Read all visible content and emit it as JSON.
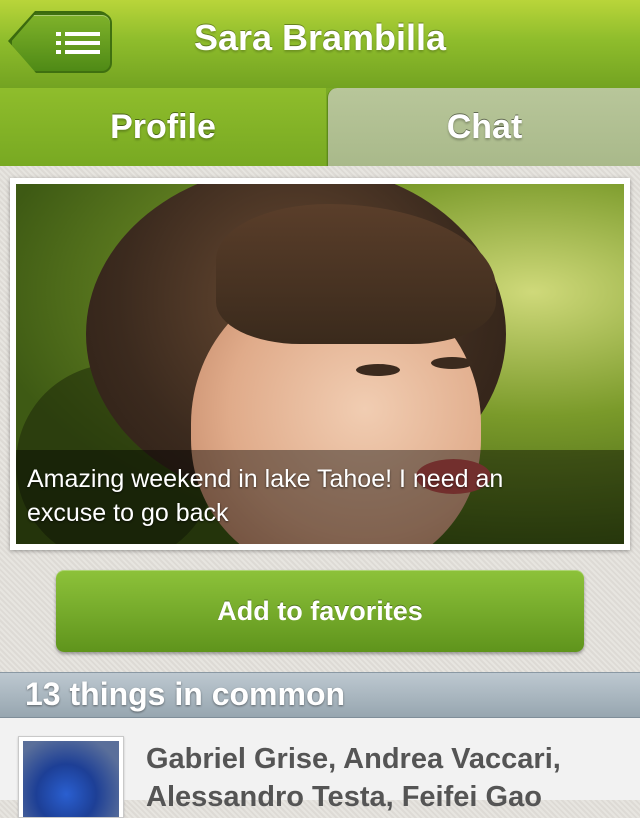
{
  "header": {
    "title": "Sara Brambilla",
    "menu_icon": "list-menu-icon"
  },
  "tabs": [
    {
      "label": "Profile",
      "active": true
    },
    {
      "label": "Chat",
      "active": false
    }
  ],
  "photo": {
    "caption": "Amazing weekend in lake Tahoe! I need an excuse to go back"
  },
  "actions": {
    "favorites_label": "Add to favorites"
  },
  "common": {
    "title": "13 things in common",
    "friends_text": "Gabriel Grise, Andrea Vaccari, Alessandro Testa, Feifei Gao"
  },
  "colors": {
    "brand_green": "#8fbd2c",
    "button_green": "#74a92a",
    "section_gray": "#a8b5be"
  }
}
